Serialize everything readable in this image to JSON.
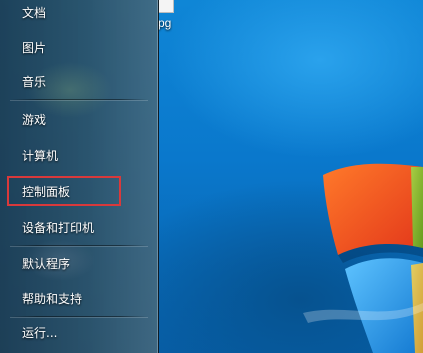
{
  "desktop": {
    "file_label_fragment": "pg",
    "logo_icon": "windows-flag-icon"
  },
  "start_menu": {
    "items": [
      {
        "label": "文档"
      },
      {
        "label": "图片"
      },
      {
        "label": "音乐"
      },
      {
        "label": "游戏"
      },
      {
        "label": "计算机"
      },
      {
        "label": "控制面板",
        "highlighted": true
      },
      {
        "label": "设备和打印机"
      },
      {
        "label": "默认程序"
      },
      {
        "label": "帮助和支持"
      },
      {
        "label": "运行..."
      }
    ]
  },
  "colors": {
    "highlight_border": "#d9393b",
    "desktop_blue": "#0a78cc",
    "menu_text": "#ffffff"
  }
}
